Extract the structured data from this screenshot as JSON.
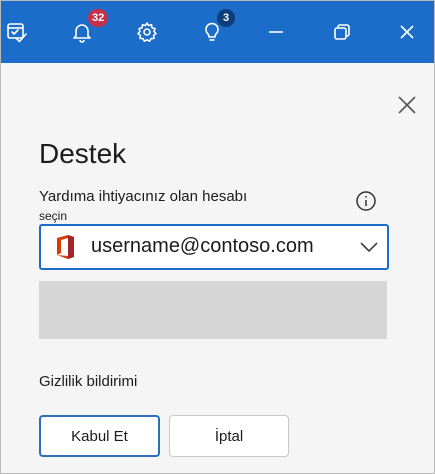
{
  "topbar": {
    "notifications_count": "32",
    "tips_count": "3",
    "colors": {
      "background": "#1c6dc9",
      "badge_red": "#c4314b",
      "badge_navy": "#0f3f7a"
    }
  },
  "panel": {
    "title": "Destek",
    "account_label_line1": "Yardıma ihtiyacınız olan hesabı",
    "account_label_line2": "seçin",
    "selected_account": "username@contoso.com",
    "privacy_label": "Gizlilik bildirimi",
    "accept_label": "Kabul Et",
    "cancel_label": "İptal",
    "accent_color": "#1c6dc9",
    "icons": [
      "calendar-check-icon",
      "bell-icon",
      "gear-icon",
      "lightbulb-icon",
      "minimize-icon",
      "restore-icon",
      "close-icon",
      "info-icon",
      "office-logo-icon",
      "chevron-down-icon"
    ]
  }
}
